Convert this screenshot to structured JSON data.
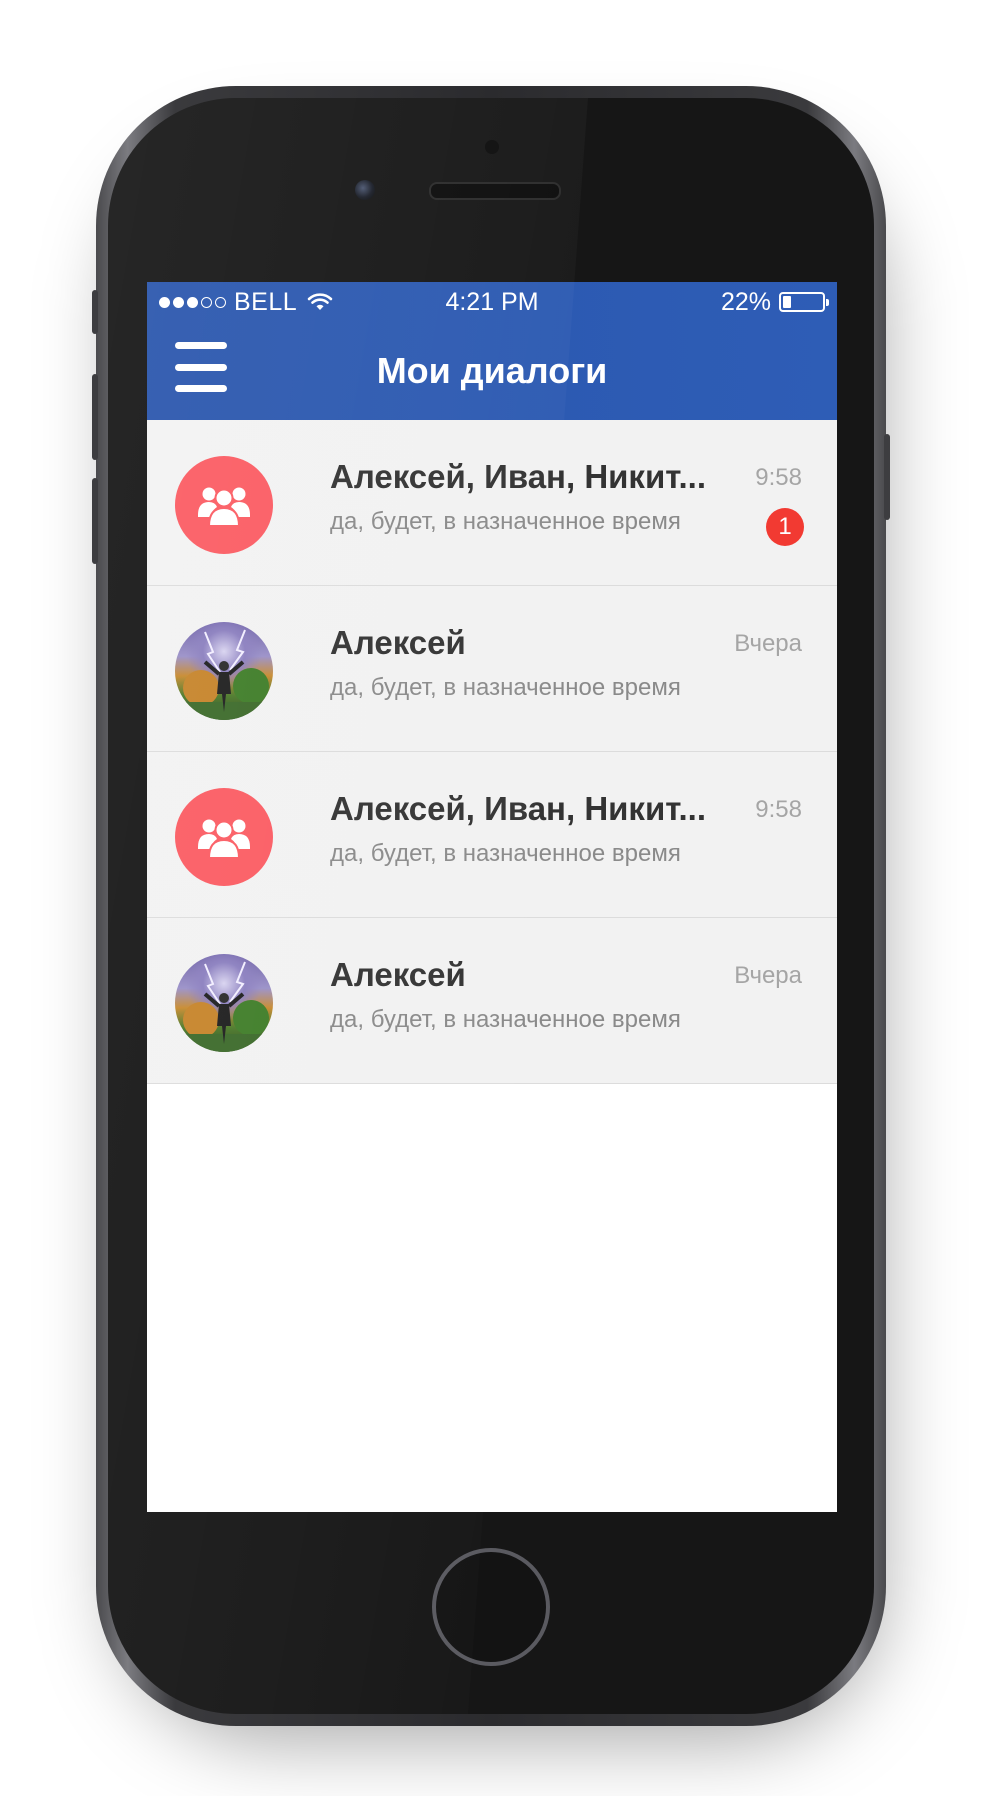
{
  "status_bar": {
    "signal_dots_filled": 3,
    "signal_dots_total": 5,
    "carrier": "BELL",
    "wifi_icon": "wifi-icon",
    "time": "4:21 PM",
    "battery_percent": "22%",
    "battery_level": 0.22
  },
  "nav": {
    "menu_icon": "hamburger-menu-icon",
    "title": "Мои диалоги"
  },
  "colors": {
    "nav_blue": "#2e5bb2",
    "group_avatar": "#fb5c63",
    "badge_red": "#f23a32",
    "row_background": "#f2f2f2"
  },
  "dialogs": [
    {
      "avatar_type": "group",
      "avatar_icon": "group-users-icon",
      "name": "Алексей, Иван, Никит...",
      "preview": "да, будет, в назначенное время",
      "time": "9:58",
      "unread": "1"
    },
    {
      "avatar_type": "photo",
      "name": "Алексей",
      "preview": "да, будет, в назначенное время",
      "time": "Вчера",
      "unread": null
    },
    {
      "avatar_type": "group",
      "avatar_icon": "group-users-icon",
      "name": "Алексей, Иван, Никит...",
      "preview": "да, будет, в назначенное время",
      "time": "9:58",
      "unread": null
    },
    {
      "avatar_type": "photo",
      "name": "Алексей",
      "preview": "да, будет, в назначенное время",
      "time": "Вчера",
      "unread": null
    }
  ]
}
